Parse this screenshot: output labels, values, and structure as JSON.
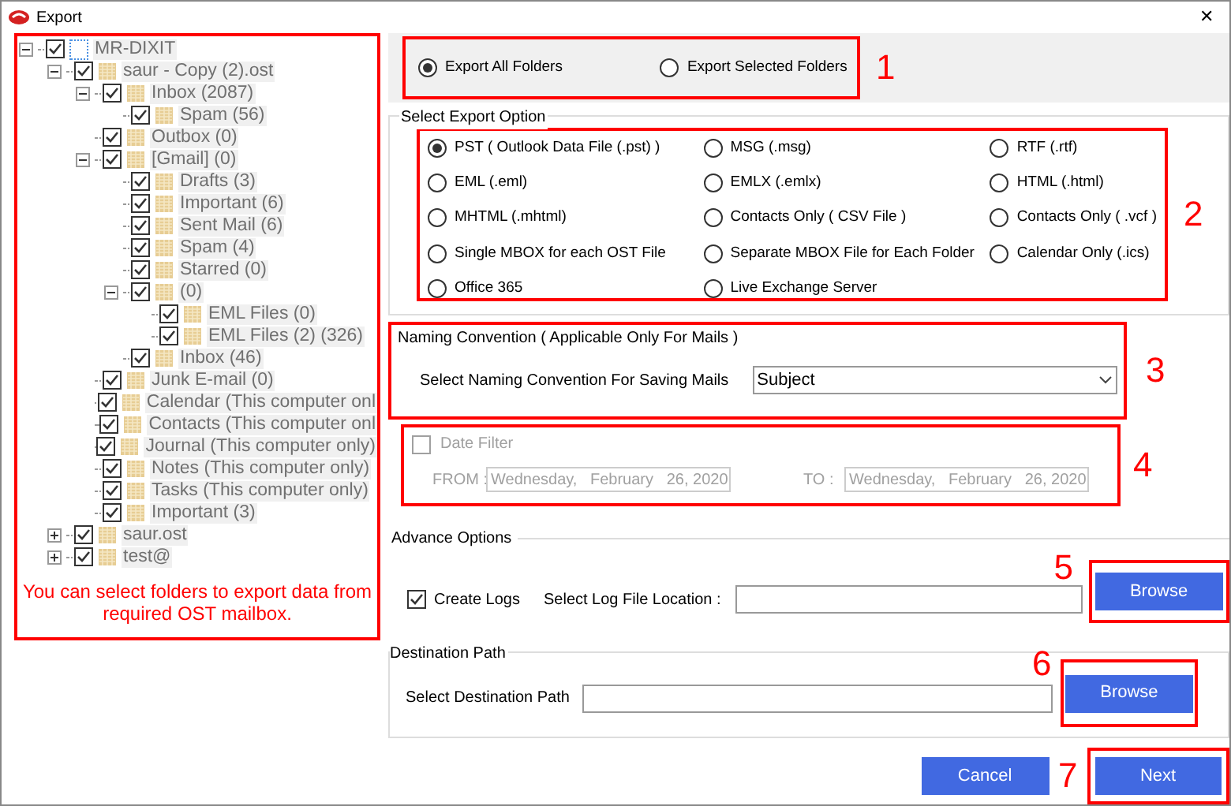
{
  "window": {
    "title": "Export",
    "close": "✕"
  },
  "tree": [
    {
      "label": "MR-DIXIT",
      "kind": "root",
      "checked": true,
      "expanded": true,
      "children": [
        {
          "label": "saur - Copy (2).ost",
          "checked": true,
          "expanded": true,
          "children": [
            {
              "label": "Inbox (2087)",
              "checked": true,
              "expanded": true,
              "children": [
                {
                  "label": "Spam (56)",
                  "checked": true
                }
              ]
            },
            {
              "label": "Outbox (0)",
              "checked": true
            },
            {
              "label": "[Gmail] (0)",
              "checked": true,
              "expanded": true,
              "children": [
                {
                  "label": "Drafts (3)",
                  "checked": true
                },
                {
                  "label": "Important (6)",
                  "checked": true
                },
                {
                  "label": "Sent Mail (6)",
                  "checked": true
                },
                {
                  "label": "Spam (4)",
                  "checked": true
                },
                {
                  "label": "Starred (0)",
                  "checked": true
                },
                {
                  "label": "(0)",
                  "checked": true,
                  "expanded": true,
                  "children": [
                    {
                      "label": "EML Files (0)",
                      "checked": true
                    },
                    {
                      "label": "EML Files (2) (326)",
                      "checked": true
                    }
                  ]
                },
                {
                  "label": "Inbox (46)",
                  "checked": true
                }
              ]
            },
            {
              "label": "Junk E-mail (0)",
              "checked": true
            },
            {
              "label": "Calendar (This computer onl",
              "checked": true
            },
            {
              "label": "Contacts (This computer onl",
              "checked": true
            },
            {
              "label": "Journal (This computer only)",
              "checked": true
            },
            {
              "label": "Notes (This computer only)",
              "checked": true
            },
            {
              "label": "Tasks (This computer only)",
              "checked": true
            },
            {
              "label": "Important (3)",
              "checked": true
            }
          ]
        },
        {
          "label": "saur.ost",
          "checked": true,
          "expanded": false
        },
        {
          "label": "test@",
          "checked": true,
          "expanded": false
        }
      ]
    }
  ],
  "tree_annotation": "You can select folders to export data from required OST mailbox.",
  "scope": [
    {
      "label": "Export All Folders",
      "selected": true
    },
    {
      "label": "Export Selected Folders",
      "selected": false
    }
  ],
  "export_option": {
    "title": "Select Export Option",
    "columns": [
      [
        {
          "label": "PST ( Outlook Data File (.pst) )",
          "selected": true
        },
        {
          "label": "EML  (.eml)",
          "selected": false
        },
        {
          "label": "MHTML (.mhtml)",
          "selected": false
        },
        {
          "label": "Single MBOX for each OST File",
          "selected": false
        },
        {
          "label": "Office 365",
          "selected": false
        }
      ],
      [
        {
          "label": "MSG  (.msg)",
          "selected": false
        },
        {
          "label": "EMLX  (.emlx)",
          "selected": false
        },
        {
          "label": "Contacts Only  ( CSV File )",
          "selected": false
        },
        {
          "label": "Separate MBOX File for Each Folder",
          "selected": false
        },
        {
          "label": "Live Exchange Server",
          "selected": false
        }
      ],
      [
        {
          "label": "RTF  (.rtf)",
          "selected": false
        },
        {
          "label": "HTML  (.html)",
          "selected": false
        },
        {
          "label": "Contacts Only  ( .vcf )",
          "selected": false
        },
        {
          "label": "Calendar Only  (.ics)",
          "selected": false
        }
      ]
    ]
  },
  "naming": {
    "title": "Naming Convention ( Applicable Only For Mails )",
    "label": "Select Naming Convention For Saving Mails",
    "value": "Subject"
  },
  "date_filter": {
    "label": "Date Filter",
    "checked": false,
    "from_label": "FROM :",
    "from": "Wednesday,   February   26, 2020",
    "to_label": "TO :",
    "to": "Wednesday,   February   26, 2020"
  },
  "advance": {
    "title": "Advance Options",
    "create_logs": {
      "label": "Create Logs",
      "checked": true
    },
    "location_label": "Select Log File Location :",
    "browse": "Browse"
  },
  "destination": {
    "title": "Destination Path",
    "label": "Select Destination Path",
    "browse": "Browse"
  },
  "buttons": {
    "cancel": "Cancel",
    "next": "Next"
  },
  "markers": [
    "1",
    "2",
    "3",
    "4",
    "5",
    "6",
    "7"
  ]
}
